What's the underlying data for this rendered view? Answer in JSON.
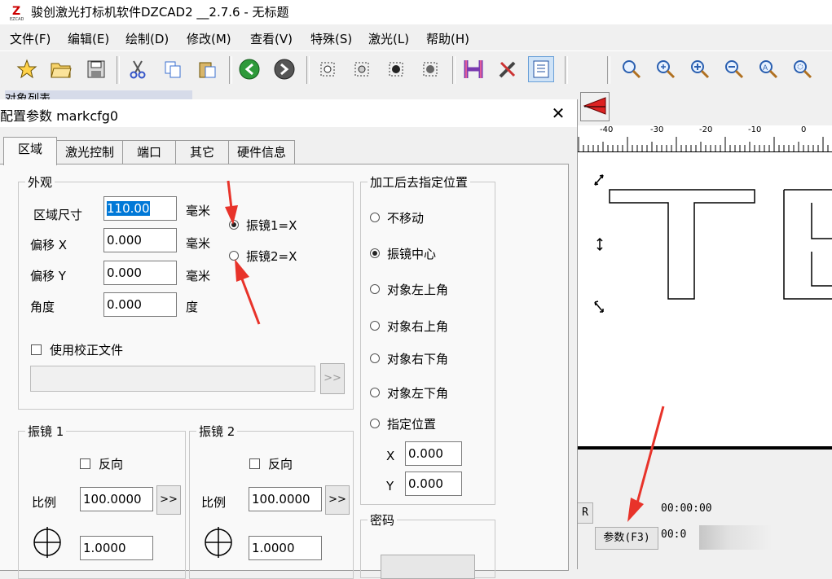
{
  "app": {
    "title": "骏创激光打标机软件DZCAD2 __2.7.6 - 无标题",
    "icon_name": "ezcad-logo-icon"
  },
  "menu": [
    "文件(F)",
    "编辑(E)",
    "绘制(D)",
    "修改(M)",
    "查看(V)",
    "特殊(S)",
    "激光(L)",
    "帮助(H)"
  ],
  "toolbar2": {
    "object_list_label": "对象列表"
  },
  "dialog": {
    "title": "配置参数 markcfg0",
    "tabs": [
      "区域",
      "激光控制",
      "端口",
      "其它",
      "硬件信息"
    ],
    "appearance": {
      "legend": "外观",
      "area_size_label": "区域尺寸",
      "area_size_value": "110.00",
      "area_size_unit": "毫米",
      "offset_x_label": "偏移 X",
      "offset_x_value": "0.000",
      "offset_x_unit": "毫米",
      "offset_y_label": "偏移 Y",
      "offset_y_value": "0.000",
      "offset_y_unit": "毫米",
      "angle_label": "角度",
      "angle_value": "0.000",
      "angle_unit": "度",
      "galvo1_x_label": "振镜1=X",
      "galvo2_x_label": "振镜2=X",
      "use_correction_label": "使用校正文件",
      "browse_label": ">>"
    },
    "galvo1": {
      "legend": "振镜 1",
      "reverse_label": "反向",
      "scale_label": "比例",
      "scale_value": "100.0000",
      "extra_value": "1.0000",
      "btn_label": ">>"
    },
    "galvo2": {
      "legend": "振镜 2",
      "reverse_label": "反向",
      "scale_label": "比例",
      "scale_value": "100.0000",
      "extra_value": "1.0000",
      "btn_label": ">>"
    },
    "after_process": {
      "legend": "加工后去指定位置",
      "options": [
        "不移动",
        "振镜中心",
        "对象左上角",
        "对象右上角",
        "对象右下角",
        "对象左下角",
        "指定位置"
      ],
      "selected_index": 1,
      "x_label": "X",
      "x_value": "0.000",
      "y_label": "Y",
      "y_value": "0.000"
    },
    "password": {
      "legend": "密码"
    }
  },
  "ruler": {
    "ticks": [
      "-40",
      "-30",
      "-20",
      "-10",
      "0"
    ]
  },
  "canvas": {
    "text": "TE"
  },
  "status": {
    "r_label": "R",
    "time1": "00:00:00",
    "time2": "00:0",
    "params_button": "参数(F3)"
  }
}
